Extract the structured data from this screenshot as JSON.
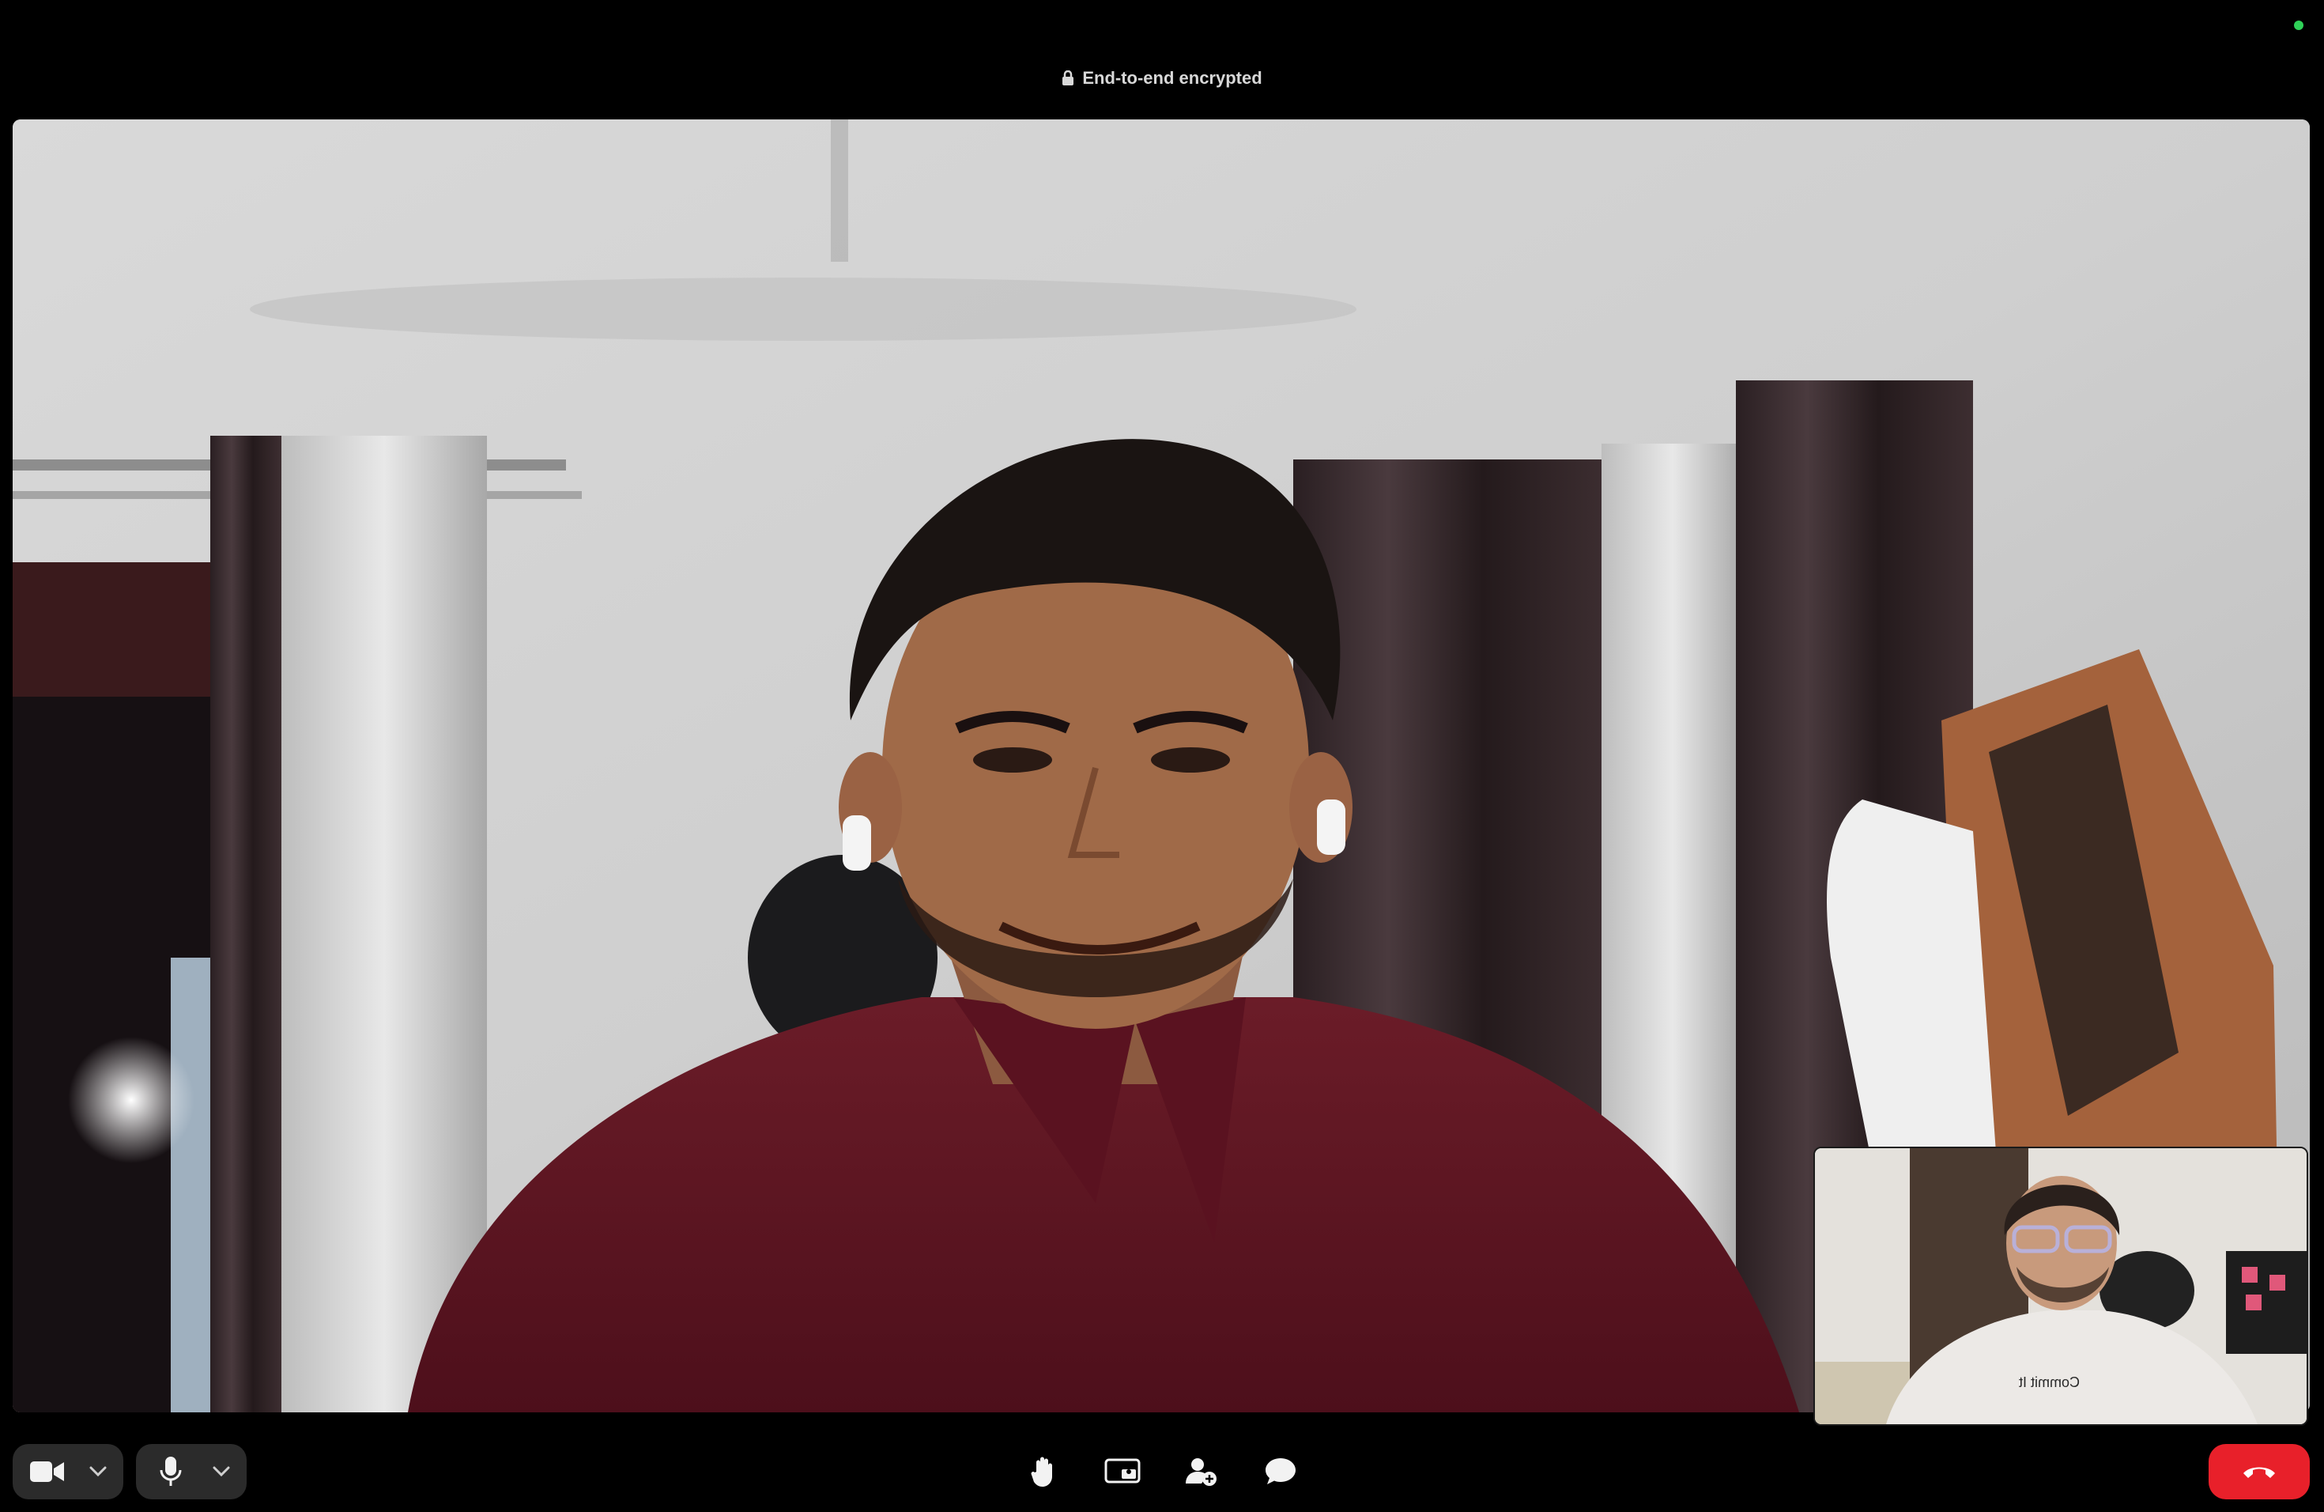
{
  "window": {
    "encryption_label": "End-to-end encrypted",
    "status_color": "#2fd158"
  },
  "participants": {
    "remote": {
      "shirt_text": ""
    },
    "self": {
      "shirt_text": "Commit It"
    }
  },
  "controls": {
    "left": [
      {
        "name": "camera-toggle",
        "icon": "video-camera-icon"
      },
      {
        "name": "camera-options",
        "icon": "chevron-down-icon"
      },
      {
        "name": "mic-toggle",
        "icon": "microphone-icon"
      },
      {
        "name": "mic-options",
        "icon": "chevron-down-icon"
      }
    ],
    "center": [
      {
        "name": "raise-hand",
        "icon": "hand-icon"
      },
      {
        "name": "share-screen",
        "icon": "screen-share-icon"
      },
      {
        "name": "add-person",
        "icon": "add-person-icon"
      },
      {
        "name": "chat",
        "icon": "chat-bubble-icon"
      }
    ],
    "end_call": {
      "icon": "end-call-icon",
      "color": "#e8202a"
    }
  }
}
